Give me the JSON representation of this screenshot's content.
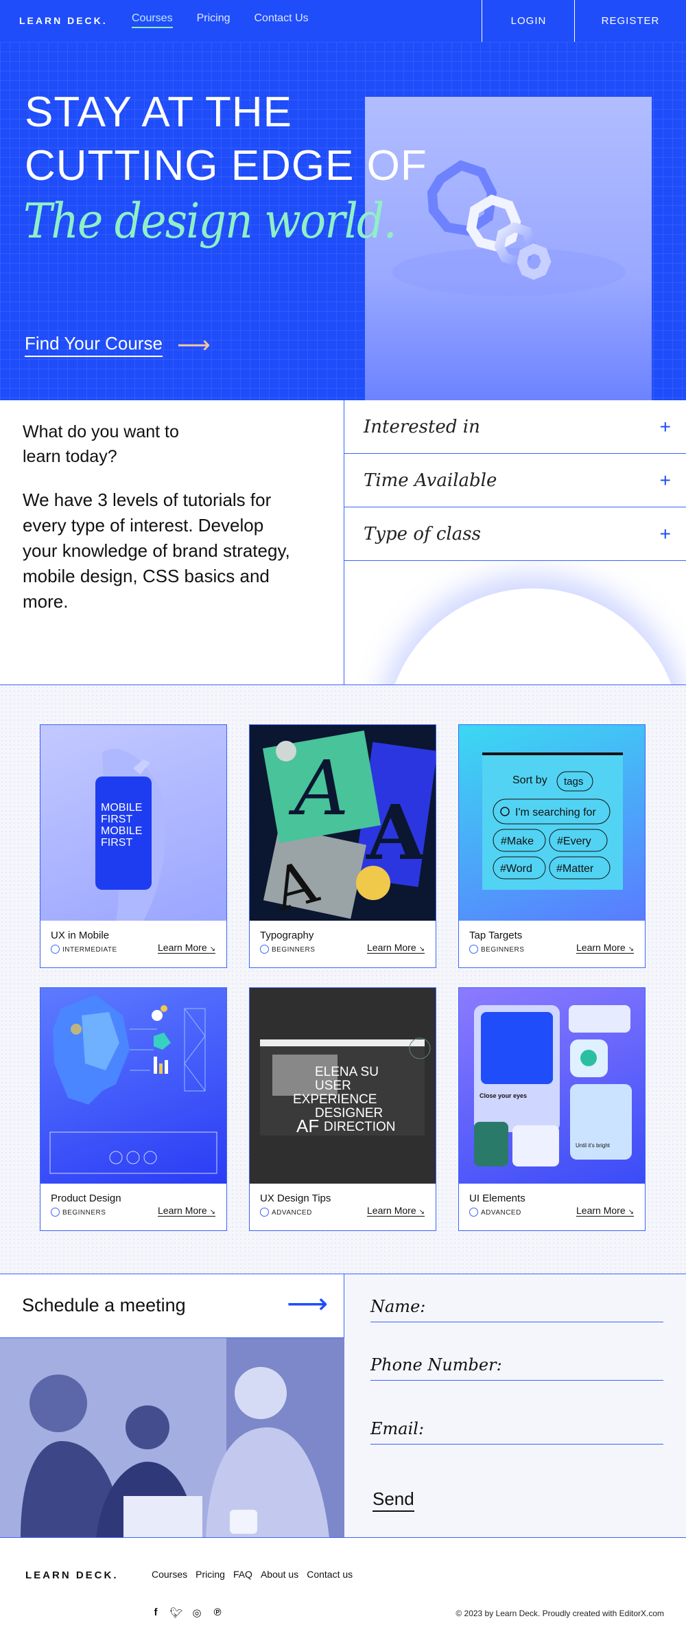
{
  "nav": {
    "logo": "LEARN DECK.",
    "links": [
      {
        "label": "Courses",
        "active": true
      },
      {
        "label": "Pricing",
        "active": false
      },
      {
        "label": "Contact Us",
        "active": false
      }
    ],
    "login": "LOGIN",
    "register": "REGISTER"
  },
  "hero": {
    "line1": "STAY AT THE",
    "line2": "CUTTING EDGE OF",
    "line3": "The design world.",
    "cta": "Find Your Course",
    "cta_icon": "arrow-right-icon"
  },
  "learn": {
    "question": "What do you want to learn today?",
    "description": "We have 3 levels of tutorials for every type of interest. Develop your knowledge of brand strategy, mobile design, CSS basics and more.",
    "filters": [
      {
        "label": "Interested in",
        "icon": "plus-icon"
      },
      {
        "label": "Time Available",
        "icon": "plus-icon"
      },
      {
        "label": "Type of class",
        "icon": "plus-icon"
      }
    ]
  },
  "courses": [
    {
      "title": "UX in Mobile",
      "level": "INTERMEDIATE",
      "more": "Learn More",
      "image_text": [
        "MOBILE",
        "FIRST",
        "MOBILE",
        "FIRST"
      ]
    },
    {
      "title": "Typography",
      "level": "BEGINNERS",
      "more": "Learn More"
    },
    {
      "title": "Tap Targets",
      "level": "BEGINNERS",
      "more": "Learn More",
      "image_text": [
        "Sort by",
        "tags",
        "I'm searching for",
        "#Make",
        "#Every",
        "#Word",
        "#Matter"
      ]
    },
    {
      "title": "Product Design",
      "level": "BEGINNERS",
      "more": "Learn More"
    },
    {
      "title": "UX Design Tips",
      "level": "ADVANCED",
      "more": "Learn More",
      "image_text": [
        "ELENA SU",
        "USER",
        "EXPERIENCE",
        "DESIGNER",
        "AF",
        "DIRECTION"
      ]
    },
    {
      "title": "UI Elements",
      "level": "ADVANCED",
      "more": "Learn More",
      "image_text": [
        "Close your eyes",
        "Until it's bright"
      ]
    }
  ],
  "schedule": {
    "title": "Schedule a meeting",
    "arrow_icon": "arrow-right-icon",
    "fields": [
      "Name:",
      "Phone Number:",
      "Email:"
    ],
    "send": "Send"
  },
  "footer": {
    "logo": "LEARN DECK.",
    "links": [
      "Courses",
      "Pricing",
      "FAQ",
      "About us",
      "Contact us"
    ],
    "social": [
      "facebook-icon",
      "twitter-icon",
      "instagram-icon",
      "pinterest-icon"
    ],
    "copyright": "© 2023 by Learn Deck. Proudly created with EditorX.com"
  },
  "colors": {
    "brand": "#1f4dfa",
    "accent": "#8ff0c6",
    "cta_arrow": "#f3c5a2"
  }
}
